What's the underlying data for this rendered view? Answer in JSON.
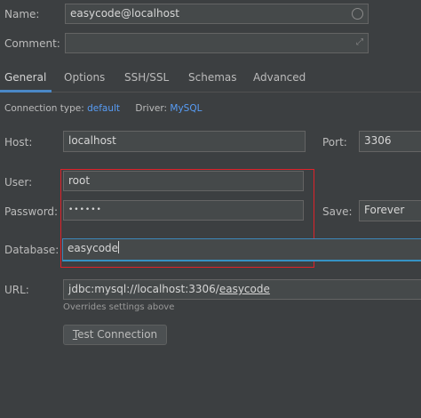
{
  "name": {
    "label": "Name:",
    "value": "easycode@localhost"
  },
  "comment": {
    "label": "Comment:",
    "value": ""
  },
  "tabs": [
    {
      "label": "General",
      "active": true
    },
    {
      "label": "Options",
      "active": false
    },
    {
      "label": "SSH/SSL",
      "active": false
    },
    {
      "label": "Schemas",
      "active": false
    },
    {
      "label": "Advanced",
      "active": false
    }
  ],
  "connection": {
    "type_label": "Connection type:",
    "type_value": "default",
    "driver_label": "Driver:",
    "driver_value": "MySQL"
  },
  "host": {
    "label": "Host:",
    "value": "localhost"
  },
  "port": {
    "label": "Port:",
    "value": "3306"
  },
  "user": {
    "label": "User:",
    "value": "root"
  },
  "password": {
    "label": "Password:",
    "value": "••••••"
  },
  "save": {
    "label": "Save:",
    "value": "Forever"
  },
  "database": {
    "label": "Database:",
    "value": "easycode"
  },
  "url": {
    "label": "URL:",
    "value_prefix": "jdbc:mysql://localhost:3306/",
    "value_db": "easycode",
    "hint": "Overrides settings above"
  },
  "test_button": {
    "mnemonic": "T",
    "rest": "est Connection"
  },
  "colors": {
    "background": "#3c3f41",
    "field_bg": "#45494a",
    "accent_blue": "#4a88c7",
    "link_blue": "#589df6",
    "highlight_red": "#e0222a"
  },
  "icons": {
    "name_field": "circle-icon",
    "comment_field": "expand-icon"
  }
}
